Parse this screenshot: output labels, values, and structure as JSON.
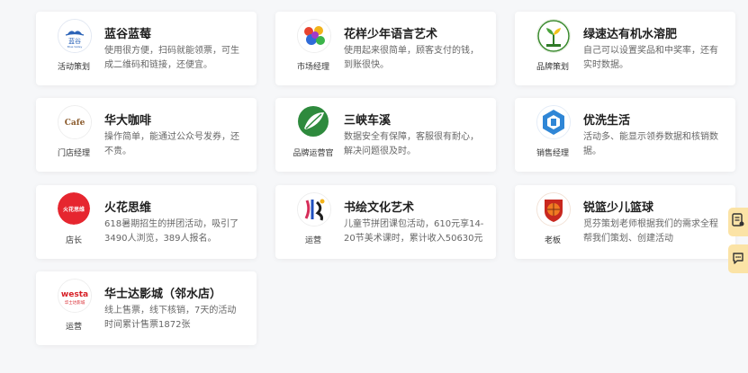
{
  "cards": [
    {
      "title": "蓝谷蓝莓",
      "role": "活动策划",
      "desc": "使用很方便，扫码就能领票，可生成二维码和链接，还便宜。",
      "icon": "blue-valley-logo-icon",
      "logo_text": "蓝谷"
    },
    {
      "title": "花样少年语言艺术",
      "role": "市场经理",
      "desc": "使用起来很简单，顾客支付的钱，到账很快。",
      "icon": "colorful-splash-logo-icon"
    },
    {
      "title": "绿速达有机水溶肥",
      "role": "品牌策划",
      "desc": "自己可以设置奖品和中奖率，还有实时数据。",
      "icon": "green-plant-logo-icon"
    },
    {
      "title": "华大咖啡",
      "role": "门店经理",
      "desc": "操作简单，能通过公众号发券，还不贵。",
      "icon": "cafe-logo-icon",
      "logo_text": "Cafe"
    },
    {
      "title": "三峡车溪",
      "role": "品牌运营官",
      "desc": "数据安全有保障，客服很有耐心，解决问题很及时。",
      "icon": "green-leaf-logo-icon"
    },
    {
      "title": "优洗生活",
      "role": "销售经理",
      "desc": "活动多、能显示领券数据和核销数据。",
      "icon": "blue-hexagon-logo-icon"
    },
    {
      "title": "火花思维",
      "role": "店长",
      "desc": "618暑期招生的拼团活动，吸引了3490人浏览，389人报名。",
      "icon": "red-circle-logo-icon",
      "logo_text": "火花思维"
    },
    {
      "title": "书绘文化艺术",
      "role": "运营",
      "desc": "儿童节拼团课包活动，610元享14-20节美术课时，累计收入50630元",
      "icon": "calligraphy-logo-icon"
    },
    {
      "title": "锐篮少儿篮球",
      "role": "老板",
      "desc": "觅芬策划老师根据我们的需求全程帮我们策划、创建活动",
      "icon": "basketball-badge-logo-icon"
    },
    {
      "title": "华士达影城（邻水店）",
      "role": "运营",
      "desc": "线上售票，线下核销，7天的活动时间累计售票1872张",
      "icon": "westa-cinema-logo-icon",
      "logo_text": "westa",
      "logo_sub": "华士达影城"
    }
  ],
  "side_tabs": [
    {
      "icon": "document-chat-icon"
    },
    {
      "icon": "message-icon"
    }
  ]
}
